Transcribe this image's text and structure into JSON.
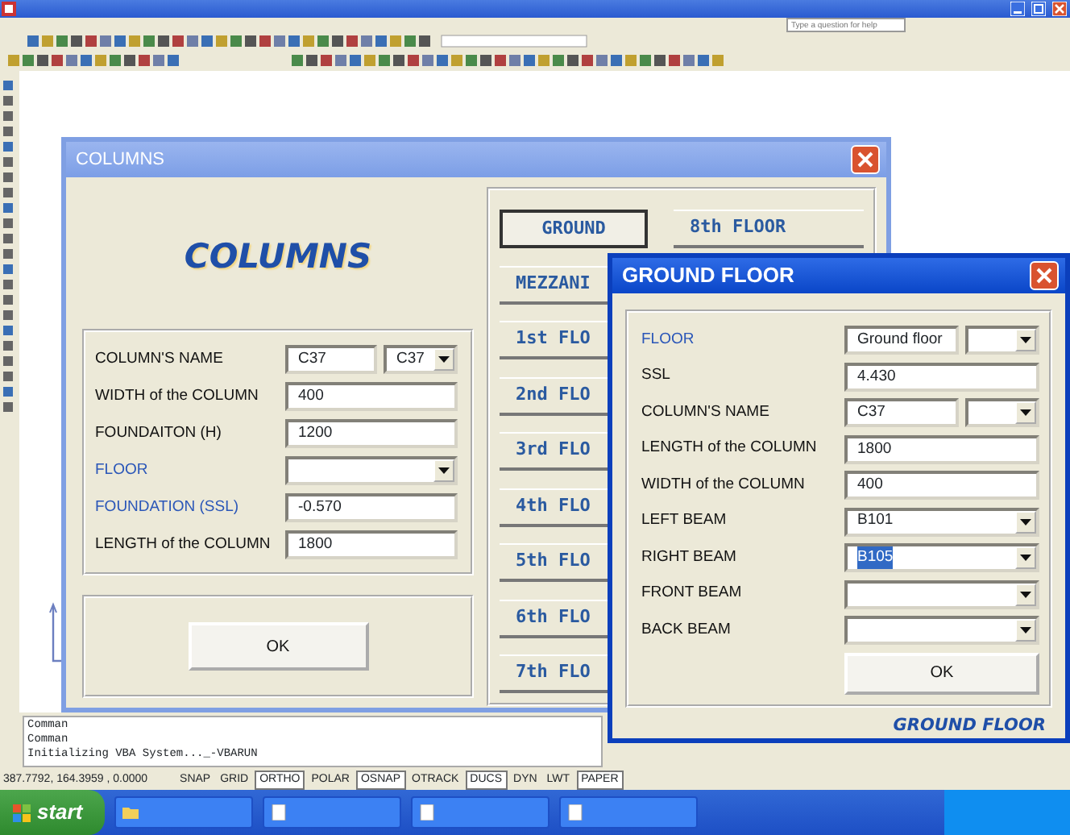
{
  "autocad": {
    "help_search": {
      "placeholder": "Type a question for help"
    },
    "command_lines": [
      "Comman",
      "Comman",
      "Initializing VBA System..._-VBARUN"
    ],
    "coordinates": "387.7792, 164.3959 , 0.0000",
    "status_toggles": [
      {
        "label": "SNAP",
        "on": false
      },
      {
        "label": "GRID",
        "on": false
      },
      {
        "label": "ORTHO",
        "on": true
      },
      {
        "label": "POLAR",
        "on": false
      },
      {
        "label": "OSNAP",
        "on": true
      },
      {
        "label": "OTRACK",
        "on": false
      },
      {
        "label": "DUCS",
        "on": true
      },
      {
        "label": "DYN",
        "on": false
      },
      {
        "label": "LWT",
        "on": false
      },
      {
        "label": "PAPER",
        "on": true
      }
    ]
  },
  "taskbar": {
    "start": "start"
  },
  "columns_dialog": {
    "title": "COLUMNS",
    "heading": "COLUMNS",
    "fields": [
      {
        "label": "COLUMN'S NAME",
        "emphasized": false,
        "kind": "text-combo",
        "value": "C37",
        "combo_value": "C37"
      },
      {
        "label": "WIDTH of the COLUMN",
        "emphasized": false,
        "kind": "text",
        "value": "400"
      },
      {
        "label": "FOUNDAITON (H)",
        "emphasized": false,
        "kind": "text",
        "value": "1200"
      },
      {
        "label": "FLOOR",
        "emphasized": true,
        "kind": "combo"
      },
      {
        "label": "FOUNDATION (SSL)",
        "emphasized": true,
        "kind": "text",
        "value": "-0.570"
      },
      {
        "label": "LENGTH of the COLUMN",
        "emphasized": false,
        "kind": "text",
        "value": "1800"
      }
    ],
    "ok": "OK",
    "floor_buttons": [
      {
        "label": "GROUND",
        "selected": true
      },
      {
        "label": "MEZZANI",
        "selected": false
      },
      {
        "label": "1st FLO",
        "selected": false
      },
      {
        "label": "2nd FLO",
        "selected": false
      },
      {
        "label": "3rd FLO",
        "selected": false
      },
      {
        "label": "4th FLO",
        "selected": false
      },
      {
        "label": "5th FLO",
        "selected": false
      },
      {
        "label": "6th FLO",
        "selected": false
      },
      {
        "label": "7th FLO",
        "selected": false
      },
      {
        "label": "8th FLOOR",
        "selected": false
      }
    ]
  },
  "ground_floor_dialog": {
    "title": "GROUND  FLOOR",
    "fields": [
      {
        "label": "FLOOR",
        "emphasized": true,
        "kind": "text-combo",
        "value": "Ground floor"
      },
      {
        "label": "SSL",
        "emphasized": false,
        "kind": "text",
        "value": "4.430"
      },
      {
        "label": "COLUMN'S NAME",
        "emphasized": false,
        "kind": "text-combo",
        "value": "C37"
      },
      {
        "label": "LENGTH of the COLUMN",
        "emphasized": false,
        "kind": "text",
        "value": "1800"
      },
      {
        "label": "WIDTH of the COLUMN",
        "emphasized": false,
        "kind": "text",
        "value": "400"
      },
      {
        "label": "LEFT BEAM",
        "emphasized": false,
        "kind": "combo",
        "value": "B101",
        "selected_text": false
      },
      {
        "label": "RIGHT BEAM",
        "emphasized": false,
        "kind": "combo",
        "value": "B105",
        "selected_text": true
      },
      {
        "label": "FRONT BEAM",
        "emphasized": false,
        "kind": "combo"
      },
      {
        "label": "BACK BEAM",
        "emphasized": false,
        "kind": "combo"
      }
    ],
    "ok": "OK",
    "footer": "GROUND  FLOOR"
  }
}
